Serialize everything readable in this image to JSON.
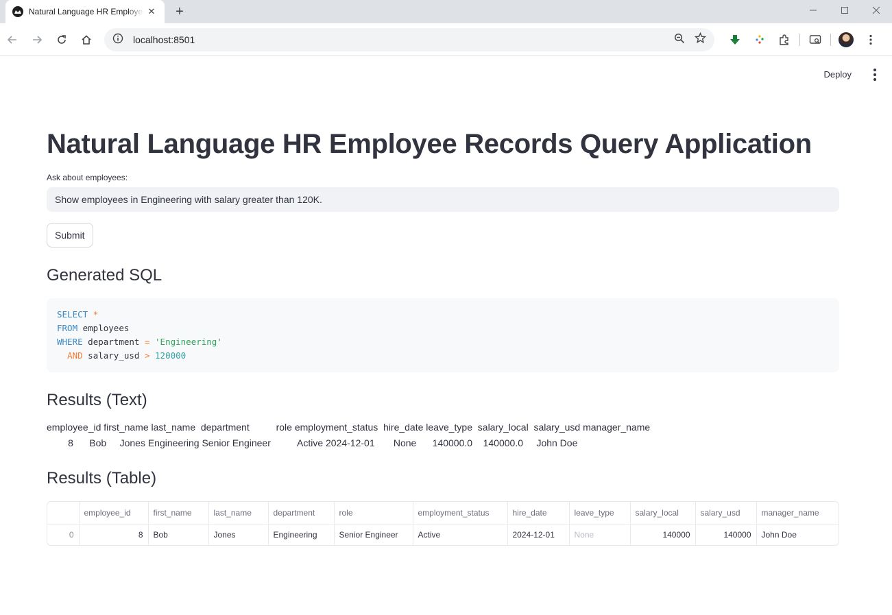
{
  "browser": {
    "tab_title": "Natural Language HR Employee Records Query Application",
    "url": "localhost:8501"
  },
  "app": {
    "deploy_label": "Deploy",
    "title": "Natural Language HR Employee Records Query Application",
    "input_label": "Ask about employees:",
    "input_value": "Show employees in Engineering with salary greater than 120K.",
    "submit_label": "Submit",
    "sql_heading": "Generated SQL",
    "sql_code": [
      [
        {
          "t": "SELECT",
          "c": "kw"
        },
        {
          "t": " "
        },
        {
          "t": "*",
          "c": "op"
        }
      ],
      [
        {
          "t": "FROM",
          "c": "kw"
        },
        {
          "t": " employees"
        }
      ],
      [
        {
          "t": "WHERE",
          "c": "kw"
        },
        {
          "t": " department "
        },
        {
          "t": "=",
          "c": "op"
        },
        {
          "t": " "
        },
        {
          "t": "'Engineering'",
          "c": "str"
        }
      ],
      [
        {
          "t": "  "
        },
        {
          "t": "AND",
          "c": "op"
        },
        {
          "t": " salary_usd "
        },
        {
          "t": ">",
          "c": "op"
        },
        {
          "t": " "
        },
        {
          "t": "120000",
          "c": "num"
        }
      ]
    ],
    "text_heading": "Results (Text)",
    "text_results": {
      "header": "employee_id first_name last_name  department          role employment_status  hire_date leave_type  salary_local  salary_usd manager_name",
      "row": "        8      Bob     Jones Engineering Senior Engineer          Active 2024-12-01       None      140000.0    140000.0     John Doe"
    },
    "table_heading": "Results (Table)",
    "table": {
      "columns": [
        "",
        "employee_id",
        "first_name",
        "last_name",
        "department",
        "role",
        "employment_status",
        "hire_date",
        "leave_type",
        "salary_local",
        "salary_usd",
        "manager_name"
      ],
      "rows": [
        [
          "0",
          "8",
          "Bob",
          "Jones",
          "Engineering",
          "Senior Engineer",
          "Active",
          "2024-12-01",
          "None",
          "140000",
          "140000",
          "John Doe"
        ]
      ]
    }
  }
}
